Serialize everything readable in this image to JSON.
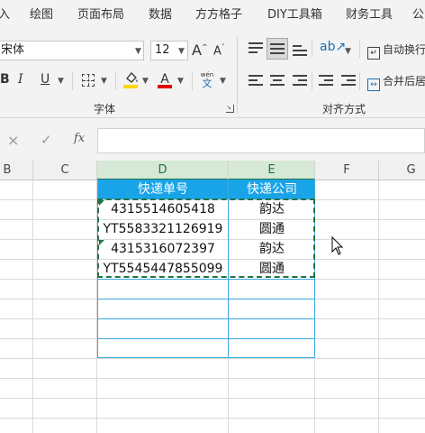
{
  "menu": {
    "tabs": [
      "入",
      "绘图",
      "页面布局",
      "数据",
      "方方格子",
      "DIY工具箱",
      "财务工具",
      "公"
    ]
  },
  "font": {
    "name": "宋体",
    "size": "12",
    "grow_label": "A",
    "shrink_label": "A",
    "bold_label": "B",
    "underline_label": "U",
    "font_color_label": "A",
    "pinyin_top": "wén",
    "pinyin_bottom": "文",
    "group_label": "字体"
  },
  "align": {
    "wrap_label": "自动换行",
    "merge_label": "合并后居",
    "group_label": "对齐方式"
  },
  "formula_bar": {
    "cancel_icon": "×",
    "confirm_icon": "✓",
    "fx_label": "fx",
    "value": ""
  },
  "columns": [
    "B",
    "C",
    "D",
    "E",
    "F",
    "G"
  ],
  "table": {
    "headers": [
      "快递单号",
      "快递公司"
    ],
    "rows": [
      [
        "4315514605418",
        "韵达"
      ],
      [
        "YT5583321126919",
        "圆通"
      ],
      [
        "4315316072397",
        "韵达"
      ],
      [
        "YT5545447855099",
        "圆通"
      ]
    ]
  },
  "colors": {
    "header_fill": "#1aa4e8",
    "table_border": "#3aa8e0",
    "copy_marquee": "#217346",
    "highlight_yellow": "#ffd800",
    "font_red": "#e00000"
  }
}
